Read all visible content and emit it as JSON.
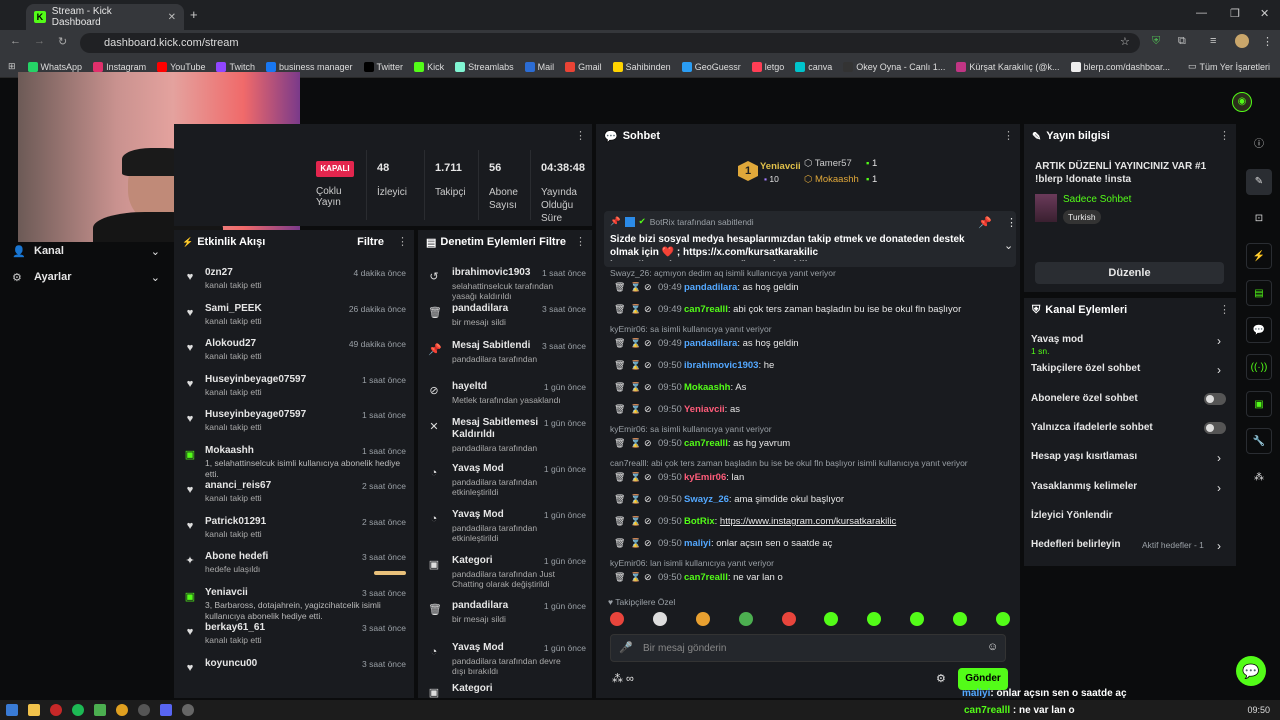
{
  "browser": {
    "tab_title": "Stream - Kick Dashboard",
    "url": "dashboard.kick.com/stream",
    "bookmarks": [
      "WhatsApp",
      "Instagram",
      "YouTube",
      "Twitch",
      "business manager",
      "Twitter",
      "Kick",
      "Streamlabs",
      "Mail",
      "Gmail",
      "Sahibinden",
      "GeoGuessr",
      "letgo",
      "canva",
      "Okey Oyna - Canlı 1...",
      "Kürşat Karakılıç (@k...",
      "blerp.com/dashboar..."
    ],
    "bookmarks_folder": "Tüm Yer İşaretleri"
  },
  "sidebar": {
    "items": [
      {
        "label": "Kanal"
      },
      {
        "label": "Ayarlar"
      }
    ]
  },
  "stats": {
    "status": "KAPALI",
    "status_label": "Çoklu Yayın",
    "cells": [
      {
        "value": "48",
        "label": "İzleyici"
      },
      {
        "value": "1.711",
        "label": "Takipçi"
      },
      {
        "value": "56",
        "label": "Abone Sayısı"
      },
      {
        "value": "04:38:48",
        "label": "Yayında Olduğu Süre"
      }
    ]
  },
  "activity": {
    "title": "Etkinlik Akışı",
    "filter": "Filtre",
    "items": [
      {
        "name": "0zn27",
        "desc": "kanalı takip etti",
        "time": "4 dakika önce",
        "type": "heart"
      },
      {
        "name": "Sami_PEEK",
        "desc": "kanalı takip etti",
        "time": "26 dakika önce",
        "type": "heart"
      },
      {
        "name": "Alokoud27",
        "desc": "kanalı takip etti",
        "time": "49 dakika önce",
        "type": "heart"
      },
      {
        "name": "Huseyinbeyage07597",
        "desc": "kanalı takip etti",
        "time": "1 saat önce",
        "type": "heart"
      },
      {
        "name": "Huseyinbeyage07597",
        "desc": "kanalı takip etti",
        "time": "1 saat önce",
        "type": "heart"
      },
      {
        "name": "Mokaashh",
        "desc": "1, selahattinselcuk isimli kullanıcıya abonelik hediye etti.",
        "time": "1 saat önce",
        "type": "gift"
      },
      {
        "name": "ananci_reis67",
        "desc": "kanalı takip etti",
        "time": "2 saat önce",
        "type": "heart"
      },
      {
        "name": "Patrick01291",
        "desc": "kanalı takip etti",
        "time": "2 saat önce",
        "type": "heart"
      },
      {
        "name": "Abone hedefi",
        "desc": "hedefe ulaşıldı",
        "time": "3 saat önce",
        "type": "star"
      },
      {
        "name": "Yeniavcii",
        "desc": "3, Barbaross, dotajahrein, yagizcihatcelik isimli kullanıcıya abonelik hediye etti.",
        "time": "3 saat önce",
        "type": "gift"
      },
      {
        "name": "berkay61_61",
        "desc": "kanalı takip etti",
        "time": "3 saat önce",
        "type": "heart"
      },
      {
        "name": "koyuncu00",
        "desc": "",
        "time": "3 saat önce",
        "type": "heart"
      }
    ]
  },
  "moderation": {
    "title": "Denetim Eylemleri",
    "filter": "Filtre",
    "items": [
      {
        "name": "ibrahimovic1903",
        "desc": "selahattinselcuk tarafından yasağı kaldırıldı",
        "time": "1 saat önce",
        "icon": "↺"
      },
      {
        "name": "pandadilara",
        "desc": "bir mesajı sildi",
        "time": "3 saat önce",
        "icon": "🗑"
      },
      {
        "name": "Mesaj Sabitlendi",
        "desc": "pandadilara tarafından",
        "time": "3 saat önce",
        "icon": "📌"
      },
      {
        "name": "hayeltd",
        "desc": "Metlek tarafından yasaklandı",
        "time": "1 gün önce",
        "icon": "⊘"
      },
      {
        "name": "Mesaj Sabitlemesi Kaldırıldı",
        "desc": "pandadilara tarafından",
        "time": "1 gün önce",
        "icon": "✕"
      },
      {
        "name": "Yavaş Mod",
        "desc": "pandadilara tarafından etkinleştirildi",
        "time": "1 gün önce",
        "icon": "◔"
      },
      {
        "name": "Yavaş Mod",
        "desc": "pandadilara tarafından etkinleştirildi",
        "time": "1 gün önce",
        "icon": "◔"
      },
      {
        "name": "Kategori",
        "desc": "pandadilara tarafından Just Chatting olarak değiştirildi",
        "time": "1 gün önce",
        "icon": "▣"
      },
      {
        "name": "pandadilara",
        "desc": "bir mesajı sildi",
        "time": "1 gün önce",
        "icon": "🗑"
      },
      {
        "name": "Yavaş Mod",
        "desc": "pandadilara tarafından devre dışı bırakıldı",
        "time": "1 gün önce",
        "icon": "◔"
      },
      {
        "name": "Kategori",
        "desc": "",
        "time": "",
        "icon": "▣"
      }
    ]
  },
  "chat": {
    "title": "Sohbet",
    "top": [
      {
        "name": "Yeniavcii",
        "count": "10"
      },
      {
        "name": "Tamer57",
        "count": "1"
      },
      {
        "name": "Mokaashh",
        "count": "1"
      }
    ],
    "pinned": {
      "by": "BotRix tarafından sabitlendi",
      "text": "Sizde bizi sosyal medya hesaplarımızdan takip etmek ve donateden destek olmak için ❤️ ; https://x.com/kursatkarakilic https://www.instagram.com/kursatkarakilic..."
    },
    "messages": [
      {
        "reply": "Swayz_26: açmıyon dedim aq isimli kullanıcıya yanıt veriyor"
      },
      {
        "time": "09:49",
        "user": "pandadilara",
        "color": "#53a8ff",
        "text": "as hoş geldin"
      },
      {
        "time": "09:49",
        "user": "can7realll",
        "color": "#53fc18",
        "text": "abi çok ters zaman başladın bu ise be okul fln başlıyor"
      },
      {
        "reply": "kyEmir06: sa isimli kullanıcıya yanıt veriyor"
      },
      {
        "time": "09:49",
        "user": "pandadilara",
        "color": "#53a8ff",
        "text": "as hoş geldin"
      },
      {
        "time": "09:50",
        "user": "ibrahimovic1903",
        "color": "#53a8ff",
        "text": "he"
      },
      {
        "time": "09:50",
        "user": "Mokaashh",
        "color": "#53fc18",
        "text": "As"
      },
      {
        "time": "09:50",
        "user": "Yeniavcii",
        "color": "#ff5c7a",
        "text": "as"
      },
      {
        "reply": "kyEmir06: sa isimli kullanıcıya yanıt veriyor"
      },
      {
        "time": "09:50",
        "user": "can7realll",
        "color": "#53fc18",
        "text": "as hg yavrum"
      },
      {
        "reply": "can7realll: abi çok ters zaman başladın bu ise be okul fln başlıyor isimli kullanıcıya yanıt veriyor"
      },
      {
        "time": "09:50",
        "user": "kyEmir06",
        "color": "#ff5c7a",
        "text": "lan"
      },
      {
        "time": "09:50",
        "user": "Swayz_26",
        "color": "#53a8ff",
        "text": "ama şimdide okul başlıyor"
      },
      {
        "time": "09:50",
        "user": "BotRix",
        "color": "#53fc18",
        "text": "https://www.instagram.com/kursatkarakilic"
      },
      {
        "time": "09:50",
        "user": "maliyi",
        "color": "#53a8ff",
        "text": "onlar açsın sen o saatde aç"
      },
      {
        "reply": "kyEmir06: lan isimli kullanıcıya yanıt veriyor"
      },
      {
        "time": "09:50",
        "user": "can7realll",
        "color": "#53fc18",
        "text": "ne var lan o"
      }
    ],
    "emote_label": "Takipçilere Özel",
    "input_placeholder": "Bir mesaj gönderin",
    "send": "Gönder"
  },
  "stream_info": {
    "title": "Yayın bilgisi",
    "headline": "ARTIK DÜZENLİ YAYINCINIZ VAR #1 !blerp !donate !insta",
    "category": "Sadece Sohbet",
    "tag": "Turkish",
    "edit": "Düzenle"
  },
  "channel_actions": {
    "title": "Kanal Eylemleri",
    "items": [
      {
        "label": "Yavaş mod",
        "sub": "1 sn.",
        "kind": "arrow"
      },
      {
        "label": "Takipçilere özel sohbet",
        "kind": "arrow"
      },
      {
        "label": "Abonelere özel sohbet",
        "kind": "toggle"
      },
      {
        "label": "Yalnızca ifadelerle sohbet",
        "kind": "toggle"
      },
      {
        "label": "Hesap yaşı kısıtlaması",
        "kind": "arrow"
      },
      {
        "label": "Yasaklanmış kelimeler",
        "kind": "arrow"
      },
      {
        "label": "İzleyici Yönlendir",
        "kind": "none"
      },
      {
        "label": "Hedefleri belirleyin",
        "sub": "Aktif hedefler - 1",
        "kind": "arrow"
      }
    ]
  },
  "overlay": [
    {
      "user": "maliyi",
      "text": "onlar açsın sen o saatde aç"
    },
    {
      "user": "can7realll",
      "text": "ne var lan o"
    }
  ],
  "taskbar": {
    "time": "09:50"
  },
  "colors": {
    "accent": "#53fc18",
    "panel": "#191b1f",
    "bg": "#0b0c0d"
  }
}
